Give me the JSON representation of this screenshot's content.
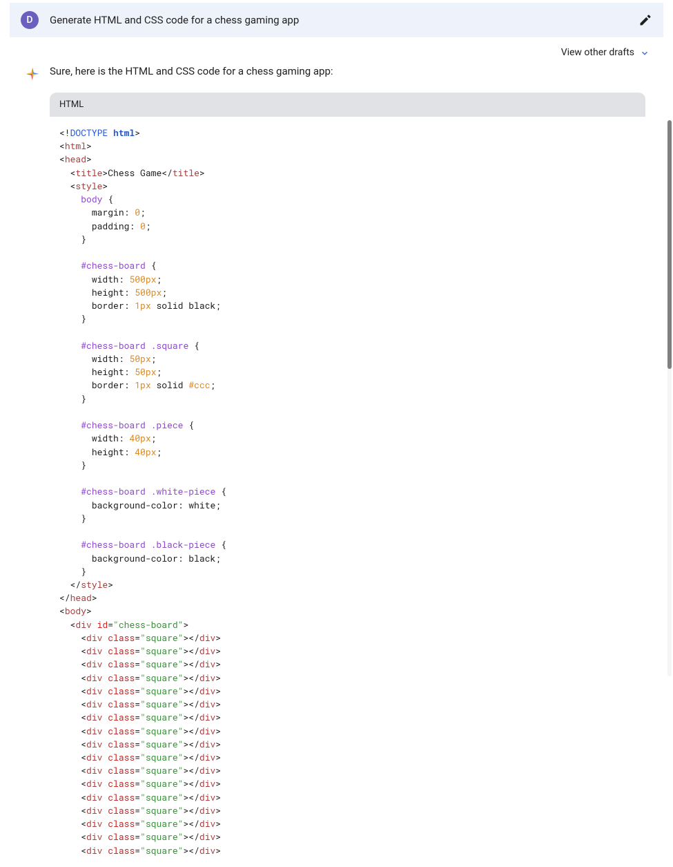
{
  "prompt": {
    "avatar_letter": "D",
    "text": "Generate HTML and CSS code for a chess gaming app"
  },
  "drafts_link": "View other drafts",
  "response": {
    "intro": "Sure, here is the HTML and CSS code for a chess gaming app:",
    "code_label": "HTML",
    "code_tokens": [
      [
        [
          "<!",
          "p"
        ],
        [
          "DOCTYPE ",
          "b"
        ],
        [
          "html",
          "bb"
        ],
        [
          ">",
          "p"
        ]
      ],
      [
        [
          "<",
          "p"
        ],
        [
          "html",
          "br"
        ],
        [
          ">",
          "p"
        ]
      ],
      [
        [
          "<",
          "p"
        ],
        [
          "head",
          "br"
        ],
        [
          ">",
          "p"
        ]
      ],
      [
        [
          "  <",
          "p"
        ],
        [
          "title",
          "br"
        ],
        [
          ">",
          "p"
        ],
        [
          "Chess Game",
          "t"
        ],
        [
          "</",
          "p"
        ],
        [
          "title",
          "br"
        ],
        [
          ">",
          "p"
        ]
      ],
      [
        [
          "  <",
          "p"
        ],
        [
          "style",
          "br"
        ],
        [
          ">",
          "p"
        ]
      ],
      [
        [
          "    ",
          "p"
        ],
        [
          "body",
          "pu"
        ],
        [
          " {",
          "p"
        ]
      ],
      [
        [
          "      ",
          "p"
        ],
        [
          "margin",
          "t"
        ],
        [
          ": ",
          "p"
        ],
        [
          "0",
          "o"
        ],
        [
          ";",
          "p"
        ]
      ],
      [
        [
          "      ",
          "p"
        ],
        [
          "padding",
          "t"
        ],
        [
          ": ",
          "p"
        ],
        [
          "0",
          "o"
        ],
        [
          ";",
          "p"
        ]
      ],
      [
        [
          "    }",
          "p"
        ]
      ],
      [
        [
          "",
          "p"
        ]
      ],
      [
        [
          "    ",
          "p"
        ],
        [
          "#chess-board",
          "pu"
        ],
        [
          " {",
          "p"
        ]
      ],
      [
        [
          "      ",
          "p"
        ],
        [
          "width",
          "t"
        ],
        [
          ": ",
          "p"
        ],
        [
          "500px",
          "o"
        ],
        [
          ";",
          "p"
        ]
      ],
      [
        [
          "      ",
          "p"
        ],
        [
          "height",
          "t"
        ],
        [
          ": ",
          "p"
        ],
        [
          "500px",
          "o"
        ],
        [
          ";",
          "p"
        ]
      ],
      [
        [
          "      ",
          "p"
        ],
        [
          "border",
          "t"
        ],
        [
          ": ",
          "p"
        ],
        [
          "1px",
          "o"
        ],
        [
          " solid black",
          [
            "t"
          ]
        ],
        [
          ";",
          "p"
        ]
      ],
      [
        [
          "    }",
          "p"
        ]
      ],
      [
        [
          "",
          "p"
        ]
      ],
      [
        [
          "    ",
          "p"
        ],
        [
          "#chess-board .square",
          "pu"
        ],
        [
          " {",
          "p"
        ]
      ],
      [
        [
          "      ",
          "p"
        ],
        [
          "width",
          "t"
        ],
        [
          ": ",
          "p"
        ],
        [
          "50px",
          "o"
        ],
        [
          ";",
          "p"
        ]
      ],
      [
        [
          "      ",
          "p"
        ],
        [
          "height",
          "t"
        ],
        [
          ": ",
          "p"
        ],
        [
          "50px",
          "o"
        ],
        [
          ";",
          "p"
        ]
      ],
      [
        [
          "      ",
          "p"
        ],
        [
          "border",
          "t"
        ],
        [
          ": ",
          "p"
        ],
        [
          "1px",
          "o"
        ],
        [
          " solid ",
          "t"
        ],
        [
          "#ccc",
          "o"
        ],
        [
          ";",
          "p"
        ]
      ],
      [
        [
          "    }",
          "p"
        ]
      ],
      [
        [
          "",
          "p"
        ]
      ],
      [
        [
          "    ",
          "p"
        ],
        [
          "#chess-board .piece",
          "pu"
        ],
        [
          " {",
          "p"
        ]
      ],
      [
        [
          "      ",
          "p"
        ],
        [
          "width",
          "t"
        ],
        [
          ": ",
          "p"
        ],
        [
          "40px",
          "o"
        ],
        [
          ";",
          "p"
        ]
      ],
      [
        [
          "      ",
          "p"
        ],
        [
          "height",
          "t"
        ],
        [
          ": ",
          "p"
        ],
        [
          "40px",
          "o"
        ],
        [
          ";",
          "p"
        ]
      ],
      [
        [
          "    }",
          "p"
        ]
      ],
      [
        [
          "",
          "p"
        ]
      ],
      [
        [
          "    ",
          "p"
        ],
        [
          "#chess-board .white-piece",
          "pu"
        ],
        [
          " {",
          "p"
        ]
      ],
      [
        [
          "      ",
          "p"
        ],
        [
          "background-color",
          "t"
        ],
        [
          ": white;",
          "p"
        ]
      ],
      [
        [
          "    }",
          "p"
        ]
      ],
      [
        [
          "",
          "p"
        ]
      ],
      [
        [
          "    ",
          "p"
        ],
        [
          "#chess-board .black-piece",
          "pu"
        ],
        [
          " {",
          "p"
        ]
      ],
      [
        [
          "      ",
          "p"
        ],
        [
          "background-color",
          "t"
        ],
        [
          ": black;",
          "p"
        ]
      ],
      [
        [
          "    }",
          "p"
        ]
      ],
      [
        [
          "  </",
          "p"
        ],
        [
          "style",
          "br"
        ],
        [
          ">",
          "p"
        ]
      ],
      [
        [
          "</",
          "p"
        ],
        [
          "head",
          "br"
        ],
        [
          ">",
          "p"
        ]
      ],
      [
        [
          "<",
          "p"
        ],
        [
          "body",
          "br"
        ],
        [
          ">",
          "p"
        ]
      ],
      [
        [
          "  <",
          "p"
        ],
        [
          "div",
          "br"
        ],
        [
          " ",
          "p"
        ],
        [
          "id",
          "r"
        ],
        [
          "=",
          "p"
        ],
        [
          "\"chess-board\"",
          "g"
        ],
        [
          ">",
          "p"
        ]
      ],
      [
        [
          "    <",
          "p"
        ],
        [
          "div",
          "br"
        ],
        [
          " ",
          "p"
        ],
        [
          "class",
          "r"
        ],
        [
          "=",
          "p"
        ],
        [
          "\"square\"",
          "g"
        ],
        [
          "></",
          "p"
        ],
        [
          "div",
          "br"
        ],
        [
          ">",
          "p"
        ]
      ],
      [
        [
          "    <",
          "p"
        ],
        [
          "div",
          "br"
        ],
        [
          " ",
          "p"
        ],
        [
          "class",
          "r"
        ],
        [
          "=",
          "p"
        ],
        [
          "\"square\"",
          "g"
        ],
        [
          "></",
          "p"
        ],
        [
          "div",
          "br"
        ],
        [
          ">",
          "p"
        ]
      ],
      [
        [
          "    <",
          "p"
        ],
        [
          "div",
          "br"
        ],
        [
          " ",
          "p"
        ],
        [
          "class",
          "r"
        ],
        [
          "=",
          "p"
        ],
        [
          "\"square\"",
          "g"
        ],
        [
          "></",
          "p"
        ],
        [
          "div",
          "br"
        ],
        [
          ">",
          "p"
        ]
      ],
      [
        [
          "    <",
          "p"
        ],
        [
          "div",
          "br"
        ],
        [
          " ",
          "p"
        ],
        [
          "class",
          "r"
        ],
        [
          "=",
          "p"
        ],
        [
          "\"square\"",
          "g"
        ],
        [
          "></",
          "p"
        ],
        [
          "div",
          "br"
        ],
        [
          ">",
          "p"
        ]
      ],
      [
        [
          "    <",
          "p"
        ],
        [
          "div",
          "br"
        ],
        [
          " ",
          "p"
        ],
        [
          "class",
          "r"
        ],
        [
          "=",
          "p"
        ],
        [
          "\"square\"",
          "g"
        ],
        [
          "></",
          "p"
        ],
        [
          "div",
          "br"
        ],
        [
          ">",
          "p"
        ]
      ],
      [
        [
          "    <",
          "p"
        ],
        [
          "div",
          "br"
        ],
        [
          " ",
          "p"
        ],
        [
          "class",
          "r"
        ],
        [
          "=",
          "p"
        ],
        [
          "\"square\"",
          "g"
        ],
        [
          "></",
          "p"
        ],
        [
          "div",
          "br"
        ],
        [
          ">",
          "p"
        ]
      ],
      [
        [
          "    <",
          "p"
        ],
        [
          "div",
          "br"
        ],
        [
          " ",
          "p"
        ],
        [
          "class",
          "r"
        ],
        [
          "=",
          "p"
        ],
        [
          "\"square\"",
          "g"
        ],
        [
          "></",
          "p"
        ],
        [
          "div",
          "br"
        ],
        [
          ">",
          "p"
        ]
      ],
      [
        [
          "    <",
          "p"
        ],
        [
          "div",
          "br"
        ],
        [
          " ",
          "p"
        ],
        [
          "class",
          "r"
        ],
        [
          "=",
          "p"
        ],
        [
          "\"square\"",
          "g"
        ],
        [
          "></",
          "p"
        ],
        [
          "div",
          "br"
        ],
        [
          ">",
          "p"
        ]
      ],
      [
        [
          "    <",
          "p"
        ],
        [
          "div",
          "br"
        ],
        [
          " ",
          "p"
        ],
        [
          "class",
          "r"
        ],
        [
          "=",
          "p"
        ],
        [
          "\"square\"",
          "g"
        ],
        [
          "></",
          "p"
        ],
        [
          "div",
          "br"
        ],
        [
          ">",
          "p"
        ]
      ],
      [
        [
          "    <",
          "p"
        ],
        [
          "div",
          "br"
        ],
        [
          " ",
          "p"
        ],
        [
          "class",
          "r"
        ],
        [
          "=",
          "p"
        ],
        [
          "\"square\"",
          "g"
        ],
        [
          "></",
          "p"
        ],
        [
          "div",
          "br"
        ],
        [
          ">",
          "p"
        ]
      ],
      [
        [
          "    <",
          "p"
        ],
        [
          "div",
          "br"
        ],
        [
          " ",
          "p"
        ],
        [
          "class",
          "r"
        ],
        [
          "=",
          "p"
        ],
        [
          "\"square\"",
          "g"
        ],
        [
          "></",
          "p"
        ],
        [
          "div",
          "br"
        ],
        [
          ">",
          "p"
        ]
      ],
      [
        [
          "    <",
          "p"
        ],
        [
          "div",
          "br"
        ],
        [
          " ",
          "p"
        ],
        [
          "class",
          "r"
        ],
        [
          "=",
          "p"
        ],
        [
          "\"square\"",
          "g"
        ],
        [
          "></",
          "p"
        ],
        [
          "div",
          "br"
        ],
        [
          ">",
          "p"
        ]
      ],
      [
        [
          "    <",
          "p"
        ],
        [
          "div",
          "br"
        ],
        [
          " ",
          "p"
        ],
        [
          "class",
          "r"
        ],
        [
          "=",
          "p"
        ],
        [
          "\"square\"",
          "g"
        ],
        [
          "></",
          "p"
        ],
        [
          "div",
          "br"
        ],
        [
          ">",
          "p"
        ]
      ],
      [
        [
          "    <",
          "p"
        ],
        [
          "div",
          "br"
        ],
        [
          " ",
          "p"
        ],
        [
          "class",
          "r"
        ],
        [
          "=",
          "p"
        ],
        [
          "\"square\"",
          "g"
        ],
        [
          "></",
          "p"
        ],
        [
          "div",
          "br"
        ],
        [
          ">",
          "p"
        ]
      ],
      [
        [
          "    <",
          "p"
        ],
        [
          "div",
          "br"
        ],
        [
          " ",
          "p"
        ],
        [
          "class",
          "r"
        ],
        [
          "=",
          "p"
        ],
        [
          "\"square\"",
          "g"
        ],
        [
          "></",
          "p"
        ],
        [
          "div",
          "br"
        ],
        [
          ">",
          "p"
        ]
      ],
      [
        [
          "    <",
          "p"
        ],
        [
          "div",
          "br"
        ],
        [
          " ",
          "p"
        ],
        [
          "class",
          "r"
        ],
        [
          "=",
          "p"
        ],
        [
          "\"square\"",
          "g"
        ],
        [
          "></",
          "p"
        ],
        [
          "div",
          "br"
        ],
        [
          ">",
          "p"
        ]
      ],
      [
        [
          "    <",
          "p"
        ],
        [
          "div",
          "br"
        ],
        [
          " ",
          "p"
        ],
        [
          "class",
          "r"
        ],
        [
          "=",
          "p"
        ],
        [
          "\"square\"",
          "g"
        ],
        [
          "></",
          "p"
        ],
        [
          "div",
          "br"
        ],
        [
          ">",
          "p"
        ]
      ]
    ]
  }
}
